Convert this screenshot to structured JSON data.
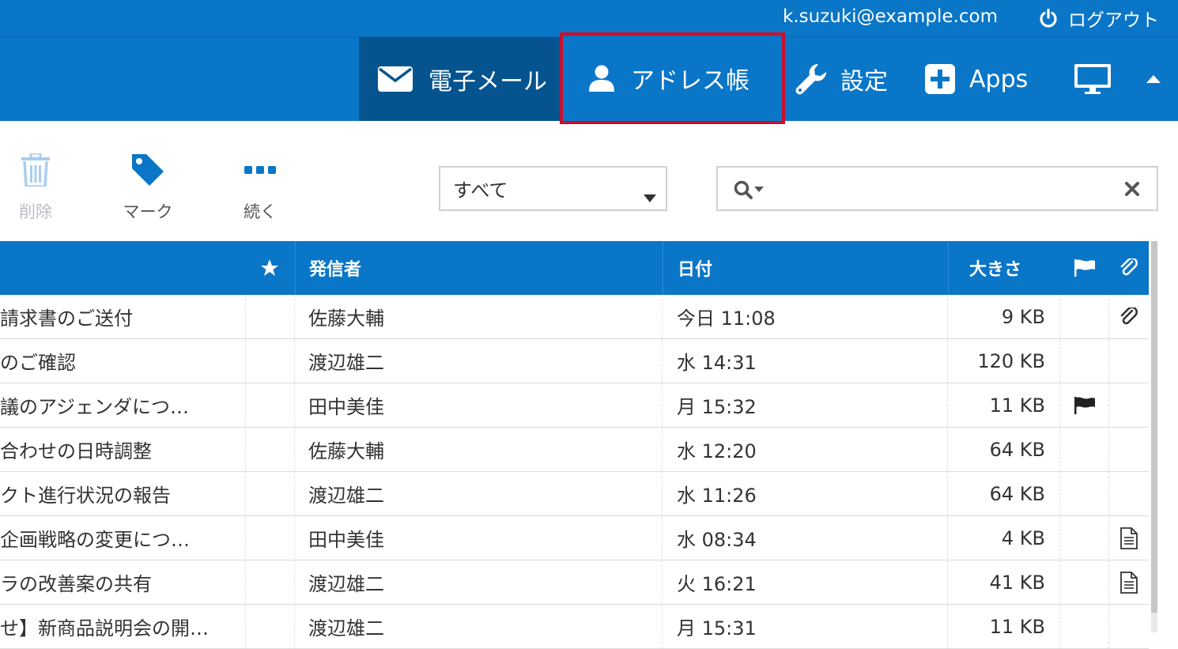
{
  "topbar": {
    "user_email": "k.suzuki@example.com",
    "logout_label": "ログアウト"
  },
  "nav": {
    "mail_label": "電子メール",
    "addressbook_label": "アドレス帳",
    "settings_label": "設定",
    "apps_label": "Apps"
  },
  "toolbar": {
    "delete_label": "削除",
    "mark_label": "マーク",
    "more_label": "続く"
  },
  "filter": {
    "selected": "すべて"
  },
  "search": {
    "value": ""
  },
  "table": {
    "columns": {
      "from": "発信者",
      "date": "日付",
      "size": "大きさ"
    },
    "rows": [
      {
        "subject": "請求書のご送付",
        "from": "佐藤大輔",
        "date": "今日 11:08",
        "size": "9 KB",
        "flag": "",
        "attach": "paperclip"
      },
      {
        "subject": "のご確認",
        "from": "渡辺雄二",
        "date": "水 14:31",
        "size": "120 KB",
        "flag": "",
        "attach": ""
      },
      {
        "subject": "議のアジェンダにつ…",
        "from": "田中美佳",
        "date": "月 15:32",
        "size": "11 KB",
        "flag": "flagged",
        "attach": ""
      },
      {
        "subject": "合わせの日時調整",
        "from": "佐藤大輔",
        "date": "水 12:20",
        "size": "64 KB",
        "flag": "",
        "attach": ""
      },
      {
        "subject": "クト進行状況の報告",
        "from": "渡辺雄二",
        "date": "水 11:26",
        "size": "64 KB",
        "flag": "",
        "attach": ""
      },
      {
        "subject": "企画戦略の変更につ…",
        "from": "田中美佳",
        "date": "水 08:34",
        "size": "4 KB",
        "flag": "",
        "attach": "document"
      },
      {
        "subject": "ラの改善案の共有",
        "from": "渡辺雄二",
        "date": "火 16:21",
        "size": "41 KB",
        "flag": "",
        "attach": "document"
      },
      {
        "subject": "せ】新商品説明会の開…",
        "from": "渡辺雄二",
        "date": "月 15:31",
        "size": "11 KB",
        "flag": "",
        "attach": ""
      }
    ]
  }
}
